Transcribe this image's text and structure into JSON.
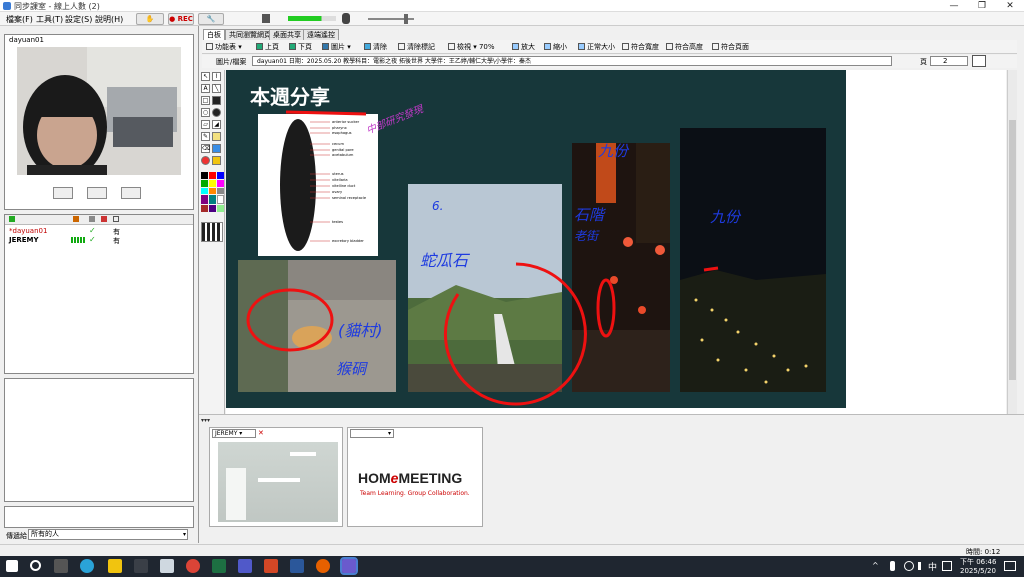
{
  "window": {
    "title": "同步課室 - 線上人數 (2)",
    "controls": [
      "—",
      "❐",
      "✕"
    ]
  },
  "menu": {
    "items": [
      "檔案(F)",
      "工具(T)",
      "設定(S)",
      "說明(H)"
    ],
    "rec_label": "REC"
  },
  "left": {
    "video_user": "dayuan01",
    "list_headers": [
      "",
      "",
      "",
      ""
    ],
    "users": [
      {
        "name": "*dayuan01",
        "status": "有",
        "color": "#c00000"
      },
      {
        "name": "JEREMY",
        "status": "有",
        "color": "#000000"
      }
    ],
    "chat_to_label": "傳遞給",
    "chat_to_value": "所有的人"
  },
  "tabs": [
    "白板",
    "共同瀏覽網頁",
    "桌面共享",
    "遠端遙控"
  ],
  "toolbar": {
    "function": "功能表",
    "prev": "上頁",
    "next": "下頁",
    "image": "圖片",
    "clear": "清除",
    "clear_mark": "清除標記",
    "zoom_label": "檢視",
    "zoom": "70%",
    "zoom_in": "放大",
    "zoom_out": "縮小",
    "normal": "正常大小",
    "fit_width": "符合寬度",
    "fit_height": "符合高度",
    "fit_page": "符合頁面"
  },
  "pathbar": {
    "label": "圖片/檔案",
    "value": "dayuan01 日期：2025.05.20 教學科目：電影之夜 拓後世界 大學伴：王乙婷/輔仁大學\\小學伴：秦杰",
    "page_label": "頁",
    "page_value": "2"
  },
  "slide": {
    "title": "本週分享",
    "handwriting": [
      "中部研究發現",
      "6.",
      "蛇瓜石",
      "九份",
      "石階",
      "九份",
      "老街",
      "(貓村)",
      "猴硐"
    ],
    "diagram_labels": [
      "anterior sucker",
      "pharynx",
      "esophagus",
      "cecum",
      "genital pore",
      "acetabulum",
      "uterus",
      "vitellaria",
      "vitelline duct",
      "ovary",
      "seminal receptacle",
      "testes",
      "excretory bladder"
    ]
  },
  "bottom": {
    "video1_user": "JEREMY",
    "logo_text_a": "HOM",
    "logo_text_e": "e",
    "logo_text_b": "MEETING",
    "logo_tagline": "Team Learning. Group Collaboration."
  },
  "status": {
    "time_label": "時間: 0:12"
  },
  "taskbar": {
    "clock_time": "下午 06:46",
    "clock_date": "2025/5/20",
    "ime": "中"
  }
}
